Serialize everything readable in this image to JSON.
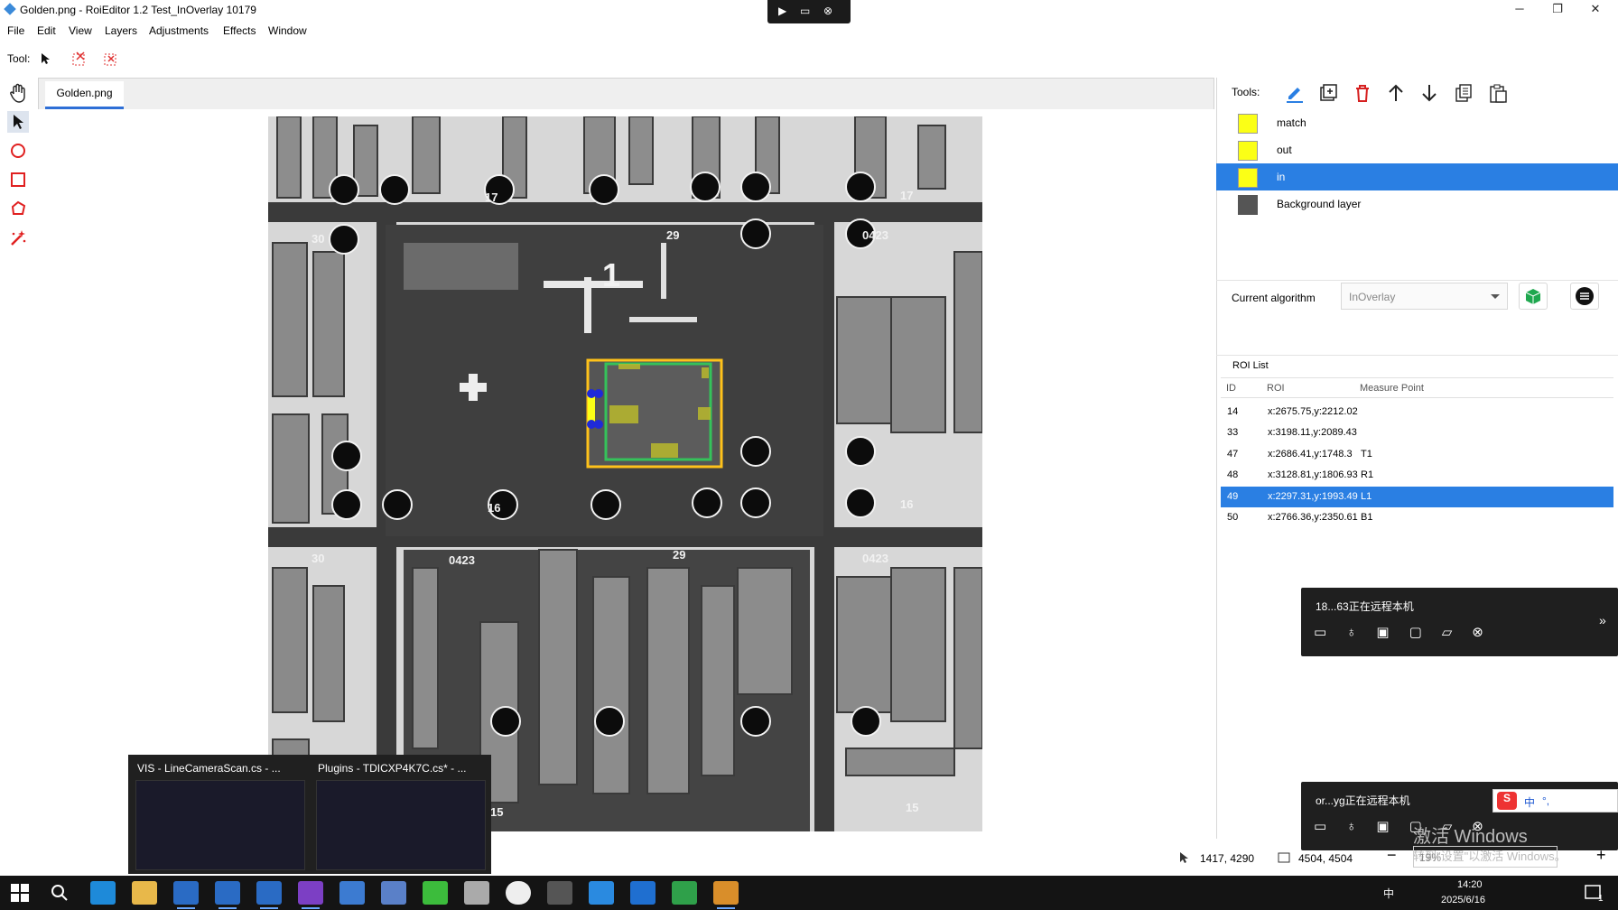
{
  "window": {
    "title": "Golden.png - RoiEditor 1.2 Test_InOverlay 10179"
  },
  "window_controls": {
    "minimize": "─",
    "maximize": "❐",
    "close": "✕"
  },
  "remote_bar": {
    "play": "▶",
    "screen": "▭",
    "close": "⊗"
  },
  "menu": [
    "File",
    "Edit",
    "View",
    "Layers",
    "Adjustments",
    "Effects",
    "Window"
  ],
  "toolbar": {
    "label": "Tool:"
  },
  "document": {
    "tab": "Golden.png"
  },
  "canvas_labels": [
    "17",
    "17",
    "30",
    "0423",
    "29",
    "16",
    "16",
    "30",
    "0423",
    "29",
    "0423",
    "15",
    "15",
    "1"
  ],
  "tools_panel": {
    "label": "Tools:"
  },
  "layers": [
    {
      "name": "match",
      "color": "#fbff16"
    },
    {
      "name": "out",
      "color": "#fbff16"
    },
    {
      "name": "in",
      "color": "#fbff16",
      "selected": true
    },
    {
      "name": "Background layer"
    }
  ],
  "algorithm": {
    "label": "Current algorithm",
    "value": "InOverlay"
  },
  "roi_list": {
    "title": "ROI List",
    "columns": [
      "ID",
      "ROI",
      "Measure Point"
    ],
    "rows": [
      {
        "id": "14",
        "roi": "x:2675.75,y:2212.02",
        "mp": ""
      },
      {
        "id": "33",
        "roi": "x:3198.11,y:2089.43",
        "mp": ""
      },
      {
        "id": "47",
        "roi": "x:2686.41,y:1748.3",
        "mp": "T1"
      },
      {
        "id": "48",
        "roi": "x:3128.81,y:1806.93",
        "mp": "R1"
      },
      {
        "id": "49",
        "roi": "x:2297.31,y:1993.49",
        "mp": "L1",
        "selected": true
      },
      {
        "id": "50",
        "roi": "x:2766.36,y:2350.61",
        "mp": "B1"
      }
    ]
  },
  "remote_popups": [
    {
      "text": "18...63正在远程本机"
    },
    {
      "text": "or...yg正在远程本机"
    }
  ],
  "watermark": {
    "line1": "激活 Windows",
    "line2": "转到\"设置\"以激活 Windows。"
  },
  "status": {
    "cursor": "1417, 4290",
    "size": "4504, 4504",
    "zoom": "19%"
  },
  "thumbnails": [
    {
      "title": "VIS - LineCameraScan.cs - ..."
    },
    {
      "title": "Plugins - TDICXP4K7C.cs* - ..."
    }
  ],
  "tray": {
    "lang": "中",
    "time": "14:20",
    "date": "2025/6/16",
    "notif_count": "1"
  },
  "ime": {
    "lang": "中",
    "punct": "°,"
  },
  "colors": {
    "accent": "#2a7fe3",
    "roi_yellow": "#fbff16",
    "roi_orange": "#ffc21a",
    "roi_green": "#35c25a"
  }
}
